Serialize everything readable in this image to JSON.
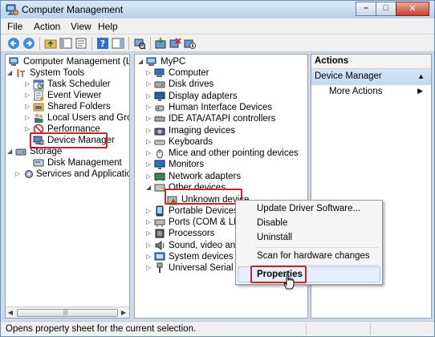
{
  "window": {
    "title": "Computer Management"
  },
  "menu": [
    "File",
    "Action",
    "View",
    "Help"
  ],
  "left_tree": {
    "root": "Computer Management (Local",
    "system_tools": "System Tools",
    "children": [
      "Task Scheduler",
      "Event Viewer",
      "Shared Folders",
      "Local Users and Groups",
      "Performance",
      "Device Manager"
    ],
    "storage": "Storage",
    "disk_management": "Disk Management",
    "services": "Services and Applications"
  },
  "device_tree": {
    "root": "MyPC",
    "categories": [
      "Computer",
      "Disk drives",
      "Display adapters",
      "Human Interface Devices",
      "IDE ATA/ATAPI controllers",
      "Imaging devices",
      "Keyboards",
      "Mice and other pointing devices",
      "Monitors",
      "Network adapters",
      "Other devices"
    ],
    "unknown_device": "Unknown device",
    "categories_after": [
      "Portable Devices",
      "Ports (COM & LPT)",
      "Processors",
      "Sound, video and g",
      "System devices",
      "Universal Serial Bus"
    ]
  },
  "actions": {
    "header": "Actions",
    "group": "Device Manager",
    "more": "More Actions"
  },
  "context_menu": {
    "items": [
      "Update Driver Software...",
      "Disable",
      "Uninstall",
      "Scan for hardware changes",
      "Properties"
    ]
  },
  "status": {
    "text": "Opens property sheet for the current selection."
  },
  "colors": {
    "highlight": "#c0262c",
    "selection": "#3399ff",
    "title_bar": "#b9d1ea"
  }
}
